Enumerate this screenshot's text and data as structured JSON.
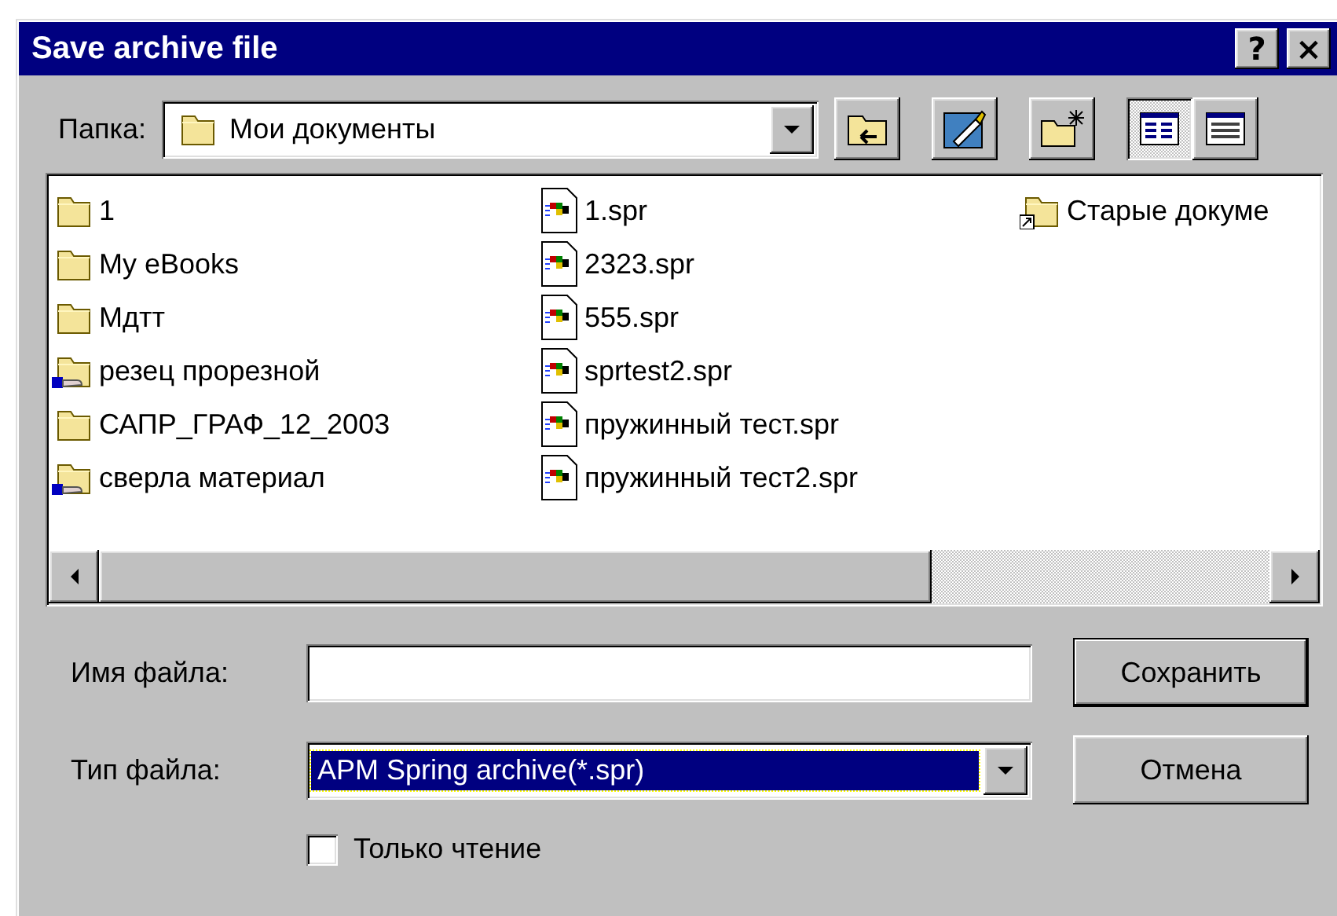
{
  "window": {
    "title": "Save archive file",
    "title_buttons": [
      {
        "kind": "help",
        "label": "?"
      },
      {
        "kind": "close",
        "label": "×"
      }
    ]
  },
  "folder": {
    "label": "Папка:",
    "value": "Мои документы"
  },
  "toolbar": [
    {
      "kind": "up-folder",
      "selected": false
    },
    {
      "kind": "desktop",
      "selected": false
    },
    {
      "kind": "new-folder",
      "selected": false
    },
    {
      "kind": "list-view",
      "selected": true
    },
    {
      "kind": "details-view",
      "selected": false
    }
  ],
  "files": [
    {
      "name": "1",
      "kind": "folder",
      "selected": false
    },
    {
      "name": "My eBooks",
      "kind": "folder",
      "selected": false
    },
    {
      "name": "Мдтт",
      "kind": "folder",
      "selected": false
    },
    {
      "name": "резец прорезной",
      "kind": "shared-folder",
      "selected": false
    },
    {
      "name": "САПР_ГРАФ_12_2003",
      "kind": "folder",
      "selected": false
    },
    {
      "name": "сверла материал",
      "kind": "shared-folder",
      "selected": false
    },
    {
      "name": "1.spr",
      "kind": "spr",
      "selected": false
    },
    {
      "name": "2323.spr",
      "kind": "spr",
      "selected": false
    },
    {
      "name": "555.spr",
      "kind": "spr",
      "selected": false
    },
    {
      "name": "sprtest2.spr",
      "kind": "spr",
      "selected": false
    },
    {
      "name": "пружинный тест.spr",
      "kind": "spr",
      "selected": false
    },
    {
      "name": "пружинный тест2.spr",
      "kind": "spr",
      "selected": false
    },
    {
      "name": "Старые докуме",
      "kind": "shortcut-folder",
      "selected": false
    }
  ],
  "file_name": {
    "label": "Имя файла:"
  },
  "file_type": {
    "label": "Тип файла:",
    "value": "APM Spring archive(*.spr)"
  },
  "read_only": {
    "label": "Только чтение",
    "checked": false
  },
  "buttons": [
    {
      "label": "Сохранить",
      "default": true
    },
    {
      "label": "Отмена",
      "default": false
    }
  ]
}
